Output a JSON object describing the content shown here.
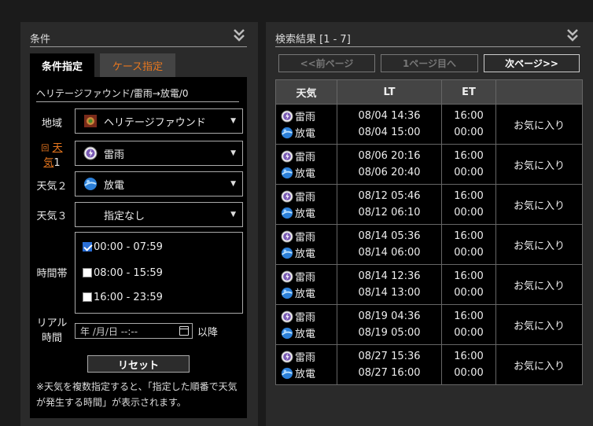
{
  "left": {
    "title": "条件",
    "tabs": {
      "condition": "条件指定",
      "case": "ケース指定"
    },
    "summary": "ヘリテージファウンド/雷雨→放電/0",
    "region": {
      "label": "地域",
      "value": "ヘリテージファウンド"
    },
    "weather1": {
      "label_a": "天",
      "label_b": "気",
      "label_num": "1",
      "value": "雷雨"
    },
    "weather2": {
      "label": "天気２",
      "value": "放電"
    },
    "weather3": {
      "label": "天気３",
      "value": "指定なし"
    },
    "time": {
      "label": "時間帯",
      "options": [
        {
          "label": "00:00 - 07:59",
          "checked": true
        },
        {
          "label": "08:00 - 15:59",
          "checked": false
        },
        {
          "label": "16:00 - 23:59",
          "checked": false
        }
      ]
    },
    "realtime": {
      "label_a": "リアル",
      "label_b": "時間",
      "placeholder": "年 /月/日  --:--",
      "after": "以降"
    },
    "reset": "リセット",
    "note": "※天気を複数指定すると、「指定した順番で天気が発生する時間」が表示されます。"
  },
  "right": {
    "title": "検索結果 [1 - 7]",
    "pager": {
      "prev": "<<前ページ",
      "first": "1ページ目へ",
      "next": "次ページ>>"
    },
    "headers": {
      "weather": "天気",
      "lt": "LT",
      "et": "ET",
      "action": ""
    },
    "rows": [
      {
        "w1": "雷雨",
        "w2": "放電",
        "lt1": "08/04 14:36",
        "lt2": "08/04 15:00",
        "et1": "16:00",
        "et2": "00:00",
        "fav": "お気に入り"
      },
      {
        "w1": "雷雨",
        "w2": "放電",
        "lt1": "08/06 20:16",
        "lt2": "08/06 20:40",
        "et1": "16:00",
        "et2": "00:00",
        "fav": "お気に入り"
      },
      {
        "w1": "雷雨",
        "w2": "放電",
        "lt1": "08/12 05:46",
        "lt2": "08/12 06:10",
        "et1": "16:00",
        "et2": "00:00",
        "fav": "お気に入り"
      },
      {
        "w1": "雷雨",
        "w2": "放電",
        "lt1": "08/14 05:36",
        "lt2": "08/14 06:00",
        "et1": "16:00",
        "et2": "00:00",
        "fav": "お気に入り"
      },
      {
        "w1": "雷雨",
        "w2": "放電",
        "lt1": "08/14 12:36",
        "lt2": "08/14 13:00",
        "et1": "16:00",
        "et2": "00:00",
        "fav": "お気に入り"
      },
      {
        "w1": "雷雨",
        "w2": "放電",
        "lt1": "08/19 04:36",
        "lt2": "08/19 05:00",
        "et1": "16:00",
        "et2": "00:00",
        "fav": "お気に入り"
      },
      {
        "w1": "雷雨",
        "w2": "放電",
        "lt1": "08/27 15:36",
        "lt2": "08/27 16:00",
        "et1": "16:00",
        "et2": "00:00",
        "fav": "お気に入り"
      }
    ]
  },
  "colors": {
    "accent": "#e8771f",
    "panel": "#2a2a2a",
    "background": "#1b1b1b"
  },
  "icons": {
    "thunder": "thunderstorm-icon",
    "discharge": "discharge-icon",
    "region": "heritagefound-icon"
  }
}
